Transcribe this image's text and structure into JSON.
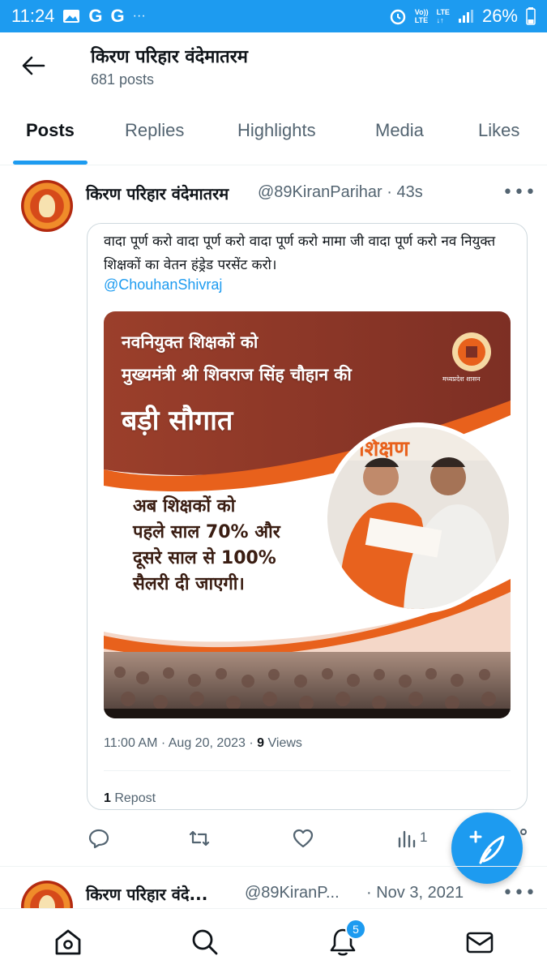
{
  "status_bar": {
    "time": "11:24",
    "g1": "G",
    "g2": "G",
    "more": "···",
    "volte_top": "Vo))",
    "volte_bottom": "LTE",
    "lte_top": "LTE",
    "lte_bottom": "↓↑",
    "battery": "26%",
    "icons": [
      "gallery-icon",
      "alarm-icon",
      "signal-icon",
      "battery-icon"
    ]
  },
  "header": {
    "title": "किरण परिहार वंदेमातरम",
    "post_count": "681 posts"
  },
  "tabs": [
    {
      "label": "Posts",
      "active": true
    },
    {
      "label": "Replies",
      "active": false
    },
    {
      "label": "Highlights",
      "active": false
    },
    {
      "label": "Media",
      "active": false
    },
    {
      "label": "Likes",
      "active": false
    }
  ],
  "post": {
    "author": "किरण परिहार वंदेमातरम",
    "handle_time": "@89KiranParihar · 43s",
    "text": "वादा पूर्ण करो वादा पूर्ण करो वादा पूर्ण करो मामा जी वादा पूर्ण करो नव नियुक्त शिक्षकों का वेतन हंड्रेड परसेंट करो।",
    "mention": "@ChouhanShivraj",
    "image": {
      "line1": "नवनियुक्त शिक्षकों को",
      "line2": "मुख्यमंत्री श्री शिवराज सिंह चौहान की",
      "headline": "बड़ी सौगात",
      "body": [
        "अब शिक्षकों को",
        "पहले साल 70% और",
        "दूसरे साल से 100%",
        "सैलरी दी जाएगी।"
      ],
      "emblem_text": "मध्यप्रदेश शासन",
      "banner_text": "शिक्षण",
      "colors": {
        "maroon": "#8e3a2a",
        "orange": "#e8611c"
      }
    },
    "time": "11:00 AM · Aug 20, 2023 · ",
    "views_count": "9",
    "views_label": " Views",
    "repost_count": "1",
    "repost_label": " Repost",
    "actions": {
      "views": "1"
    }
  },
  "post2": {
    "author": "किरण परिहार वंदे...",
    "handle": "@89KiranP...",
    "date": "· Nov 3, 2021"
  },
  "more_label": "•••",
  "nav": {
    "notifications_badge": "5",
    "items": [
      "home-icon",
      "search-icon",
      "notifications-icon",
      "messages-icon"
    ]
  },
  "accent_color": "#1d9bf0"
}
